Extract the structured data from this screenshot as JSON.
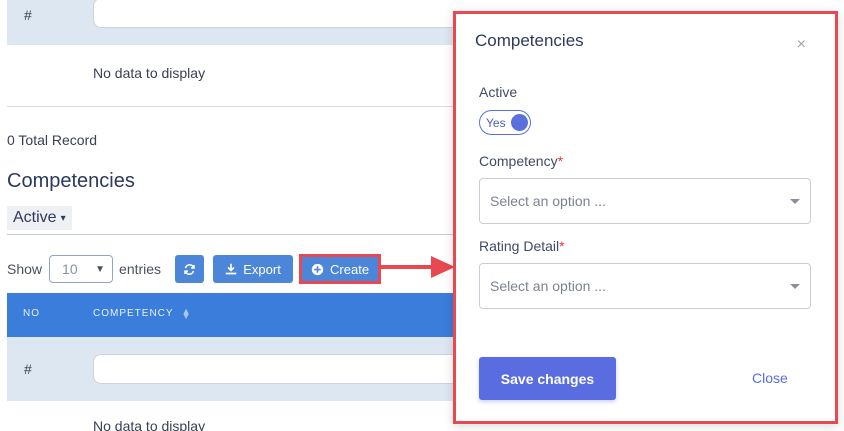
{
  "background": {
    "top_table": {
      "row_label": "#",
      "empty_text": "No data to display"
    },
    "total_record": "0 Total Record",
    "section_title": "Competencies",
    "status_filter": "Active",
    "toolbar": {
      "show_label": "Show",
      "entries_value": "10",
      "entries_label": "entries",
      "export_label": "Export",
      "create_label": "Create"
    },
    "table": {
      "headers": [
        "NO",
        "COMPETENCY"
      ],
      "row_label": "#",
      "empty_text": "No data to display"
    }
  },
  "modal": {
    "title": "Competencies",
    "close_icon": "×",
    "active_label": "Active",
    "active_toggle_text": "Yes",
    "active_value": true,
    "competency_label": "Competency",
    "competency_placeholder": "Select an option ...",
    "rating_label": "Rating Detail",
    "rating_placeholder": "Select an option ...",
    "required_mark": "*",
    "save_label": "Save changes",
    "close_label": "Close"
  },
  "colors": {
    "primary": "#5a6de0",
    "table_header": "#3a7ddb",
    "highlight": "#e8484f"
  },
  "icons": [
    "refresh-icon",
    "download-icon",
    "plus-circle-icon",
    "sort-icon",
    "close-icon",
    "caret-down-icon"
  ]
}
